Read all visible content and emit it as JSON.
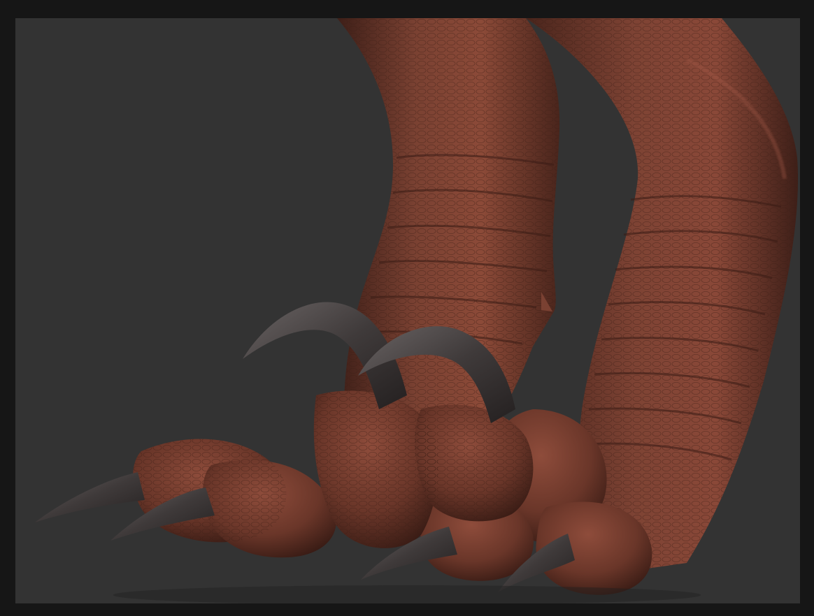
{
  "scene": {
    "subject": "sculpted-creature-feet",
    "colors": {
      "background": "#333333",
      "border": "#161616",
      "skin_base": "#6e3a2c",
      "skin_light": "#8c4a38",
      "skin_dark": "#3e1f18",
      "claw_base": "#3a3535",
      "claw_light": "#6a6464"
    }
  }
}
